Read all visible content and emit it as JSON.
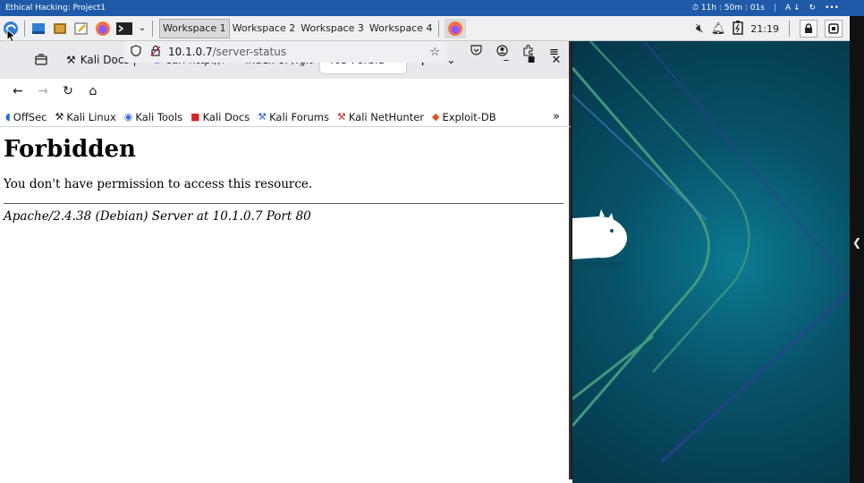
{
  "labbar": {
    "title": "Ethical Hacking: Project1",
    "timer": "⏱ 11h : 50m : 01s",
    "lang": "A ↓",
    "sync": "↻",
    "more": "•••"
  },
  "taskbar": {
    "workspaces": [
      "Workspace 1",
      "Workspace 2",
      "Workspace 3",
      "Workspace 4"
    ],
    "clock": "21:19"
  },
  "browser": {
    "tabs": [
      {
        "icon": "kali-icon",
        "label": "Kali Docs | K",
        "glyph": "⚒"
      },
      {
        "icon": "google-icon",
        "label": "curl http://1",
        "glyph": "G"
      },
      {
        "icon": "none",
        "label": "Index of /.git",
        "glyph": ""
      },
      {
        "icon": "none",
        "label": "403 Forbidde",
        "glyph": "",
        "active": true
      }
    ],
    "url_host": "10.1.0.7",
    "url_path": "/server-status",
    "bookmarks": [
      {
        "label": "OffSec",
        "glyph": "◖"
      },
      {
        "label": "Kali Linux",
        "glyph": "⚒"
      },
      {
        "label": "Kali Tools",
        "glyph": "◉"
      },
      {
        "label": "Kali Docs",
        "glyph": "■"
      },
      {
        "label": "Kali Forums",
        "glyph": "⚒"
      },
      {
        "label": "Kali NetHunter",
        "glyph": "⚒"
      },
      {
        "label": "Exploit-DB",
        "glyph": "◆"
      }
    ]
  },
  "page": {
    "heading": "Forbidden",
    "message": "You don't have permission to access this resource.",
    "server": "Apache/2.4.38 (Debian) Server at 10.1.0.7 Port 80"
  },
  "colors": {
    "labbar": "#1f5aa8",
    "desktop": "#085268",
    "desktop_line_1": "#3f9a7c",
    "desktop_line_2": "#4f7fc6"
  }
}
